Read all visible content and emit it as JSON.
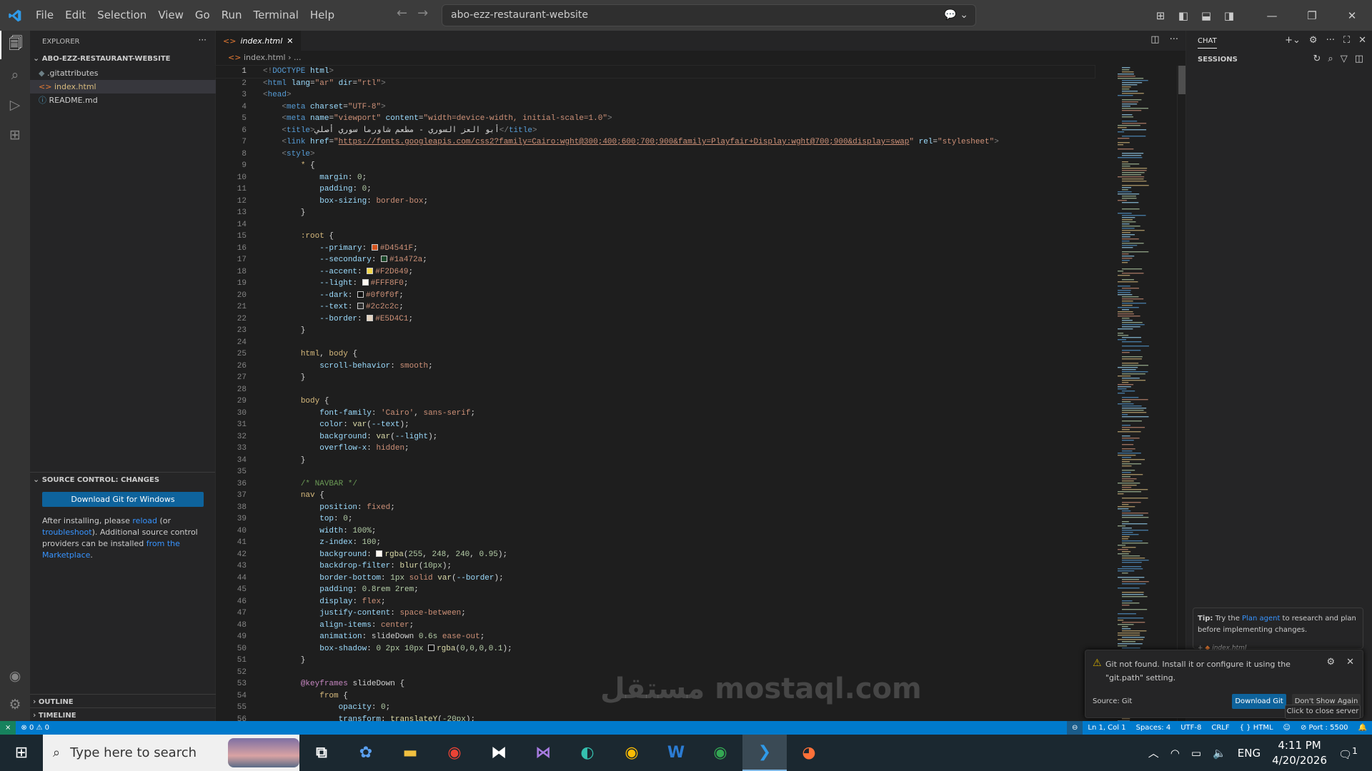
{
  "titlebar": {
    "menu": [
      "File",
      "Edit",
      "Selection",
      "View",
      "Go",
      "Run",
      "Terminal",
      "Help"
    ],
    "command_center": "abo-ezz-restaurant-website"
  },
  "sidebar": {
    "title": "EXPLORER",
    "more": "···",
    "folder": "ABO-EZZ-RESTAURANT-WEBSITE",
    "files": [
      ".gitattributes",
      "index.html",
      "README.md"
    ],
    "scm_title": "SOURCE CONTROL: CHANGES",
    "git_button": "Download Git for Windows",
    "scm_text": [
      "After installing, please ",
      "reload",
      " (or ",
      "troubleshoot",
      "). Additional source control providers can be installed ",
      "from the Marketplace",
      "."
    ],
    "outline": "OUTLINE",
    "timeline": "TIMELINE"
  },
  "editor": {
    "tab": "index.html",
    "breadcrumb": [
      "index.html",
      "..."
    ],
    "lines": [
      [
        [
          "b",
          "<!"
        ],
        [
          "t",
          "DOCTYPE "
        ],
        [
          "a",
          "html"
        ],
        [
          "b",
          ">"
        ]
      ],
      [
        [
          "b",
          "<"
        ],
        [
          "t",
          "html "
        ],
        [
          "a",
          "lang"
        ],
        [
          "p",
          "="
        ],
        [
          "s",
          "\"ar\" "
        ],
        [
          "a",
          "dir"
        ],
        [
          "p",
          "="
        ],
        [
          "s",
          "\"rtl\""
        ],
        [
          "b",
          ">"
        ]
      ],
      [
        [
          "b",
          "<"
        ],
        [
          "t",
          "head"
        ],
        [
          "b",
          ">"
        ]
      ],
      [
        [
          "p",
          "    "
        ],
        [
          "b",
          "<"
        ],
        [
          "t",
          "meta "
        ],
        [
          "a",
          "charset"
        ],
        [
          "p",
          "="
        ],
        [
          "s",
          "\"UTF-8\""
        ],
        [
          "b",
          ">"
        ]
      ],
      [
        [
          "p",
          "    "
        ],
        [
          "b",
          "<"
        ],
        [
          "t",
          "meta "
        ],
        [
          "a",
          "name"
        ],
        [
          "p",
          "="
        ],
        [
          "s",
          "\"viewport\" "
        ],
        [
          "a",
          "content"
        ],
        [
          "p",
          "="
        ],
        [
          "s",
          "\"width=device-width, initial-scale=1.0\""
        ],
        [
          "b",
          ">"
        ]
      ],
      [
        [
          "p",
          "    "
        ],
        [
          "b",
          "<"
        ],
        [
          "t",
          "title"
        ],
        [
          "b",
          ">"
        ],
        [
          "p",
          "أبو العز السوري - مطعم شاورما سوري أصلي"
        ],
        [
          "b",
          "</"
        ],
        [
          "t",
          "title"
        ],
        [
          "b",
          ">"
        ]
      ],
      [
        [
          "p",
          "    "
        ],
        [
          "b",
          "<"
        ],
        [
          "t",
          "link "
        ],
        [
          "a",
          "href"
        ],
        [
          "p",
          "="
        ],
        [
          "s",
          "\""
        ],
        [
          "u",
          "https://fonts.googleapis.com/css2?family=Cairo:wght@300;400;600;700;900&family=Playfair+Display:wght@700;900&display=swap"
        ],
        [
          "s",
          "\" "
        ],
        [
          "a",
          "rel"
        ],
        [
          "p",
          "="
        ],
        [
          "s",
          "\"stylesheet\""
        ],
        [
          "b",
          ">"
        ]
      ],
      [
        [
          "p",
          "    "
        ],
        [
          "b",
          "<"
        ],
        [
          "t",
          "style"
        ],
        [
          "b",
          ">"
        ]
      ],
      [
        [
          "p",
          "        "
        ],
        [
          "sel",
          "* "
        ],
        [
          "p",
          "{"
        ]
      ],
      [
        [
          "p",
          "            "
        ],
        [
          "a",
          "margin"
        ],
        [
          "p",
          ": "
        ],
        [
          "n",
          "0"
        ],
        [
          "p",
          ";"
        ]
      ],
      [
        [
          "p",
          "            "
        ],
        [
          "a",
          "padding"
        ],
        [
          "p",
          ": "
        ],
        [
          "n",
          "0"
        ],
        [
          "p",
          ";"
        ]
      ],
      [
        [
          "p",
          "            "
        ],
        [
          "a",
          "box-sizing"
        ],
        [
          "p",
          ": "
        ],
        [
          "s",
          "border-box"
        ],
        [
          "p",
          ";"
        ]
      ],
      [
        [
          "p",
          "        }"
        ]
      ],
      [],
      [
        [
          "p",
          "        "
        ],
        [
          "sel",
          ":root "
        ],
        [
          "p",
          "{"
        ]
      ],
      [
        [
          "p",
          "            "
        ],
        [
          "a",
          "--primary"
        ],
        [
          "p",
          ": "
        ],
        [
          "sw",
          "#D4541F"
        ],
        [
          "s",
          "#D4541F"
        ],
        [
          "p",
          ";"
        ]
      ],
      [
        [
          "p",
          "            "
        ],
        [
          "a",
          "--secondary"
        ],
        [
          "p",
          ": "
        ],
        [
          "sw",
          "#1a472a"
        ],
        [
          "s",
          "#1a472a"
        ],
        [
          "p",
          ";"
        ]
      ],
      [
        [
          "p",
          "            "
        ],
        [
          "a",
          "--accent"
        ],
        [
          "p",
          ": "
        ],
        [
          "sw",
          "#F2D649"
        ],
        [
          "s",
          "#F2D649"
        ],
        [
          "p",
          ";"
        ]
      ],
      [
        [
          "p",
          "            "
        ],
        [
          "a",
          "--light"
        ],
        [
          "p",
          ": "
        ],
        [
          "sw",
          "#FFF8F0"
        ],
        [
          "s",
          "#FFF8F0"
        ],
        [
          "p",
          ";"
        ]
      ],
      [
        [
          "p",
          "            "
        ],
        [
          "a",
          "--dark"
        ],
        [
          "p",
          ": "
        ],
        [
          "sw",
          "#0f0f0f"
        ],
        [
          "s",
          "#0f0f0f"
        ],
        [
          "p",
          ";"
        ]
      ],
      [
        [
          "p",
          "            "
        ],
        [
          "a",
          "--text"
        ],
        [
          "p",
          ": "
        ],
        [
          "sw",
          "#2c2c2c"
        ],
        [
          "s",
          "#2c2c2c"
        ],
        [
          "p",
          ";"
        ]
      ],
      [
        [
          "p",
          "            "
        ],
        [
          "a",
          "--border"
        ],
        [
          "p",
          ": "
        ],
        [
          "sw",
          "#E5D4C1"
        ],
        [
          "s",
          "#E5D4C1"
        ],
        [
          "p",
          ";"
        ]
      ],
      [
        [
          "p",
          "        }"
        ]
      ],
      [],
      [
        [
          "p",
          "        "
        ],
        [
          "sel",
          "html"
        ],
        [
          "p",
          ", "
        ],
        [
          "sel",
          "body "
        ],
        [
          "p",
          "{"
        ]
      ],
      [
        [
          "p",
          "            "
        ],
        [
          "a",
          "scroll-behavior"
        ],
        [
          "p",
          ": "
        ],
        [
          "s",
          "smooth"
        ],
        [
          "p",
          ";"
        ]
      ],
      [
        [
          "p",
          "        }"
        ]
      ],
      [],
      [
        [
          "p",
          "        "
        ],
        [
          "sel",
          "body "
        ],
        [
          "p",
          "{"
        ]
      ],
      [
        [
          "p",
          "            "
        ],
        [
          "a",
          "font-family"
        ],
        [
          "p",
          ": "
        ],
        [
          "s",
          "'Cairo'"
        ],
        [
          "p",
          ", "
        ],
        [
          "s",
          "sans-serif"
        ],
        [
          "p",
          ";"
        ]
      ],
      [
        [
          "p",
          "            "
        ],
        [
          "a",
          "color"
        ],
        [
          "p",
          ": "
        ],
        [
          "f",
          "var"
        ],
        [
          "p",
          "("
        ],
        [
          "a",
          "--text"
        ],
        [
          "p",
          ");"
        ]
      ],
      [
        [
          "p",
          "            "
        ],
        [
          "a",
          "background"
        ],
        [
          "p",
          ": "
        ],
        [
          "f",
          "var"
        ],
        [
          "p",
          "("
        ],
        [
          "a",
          "--light"
        ],
        [
          "p",
          ");"
        ]
      ],
      [
        [
          "p",
          "            "
        ],
        [
          "a",
          "overflow-x"
        ],
        [
          "p",
          ": "
        ],
        [
          "s",
          "hidden"
        ],
        [
          "p",
          ";"
        ]
      ],
      [
        [
          "p",
          "        }"
        ]
      ],
      [],
      [
        [
          "p",
          "        "
        ],
        [
          "c",
          "/* NAVBAR */"
        ]
      ],
      [
        [
          "p",
          "        "
        ],
        [
          "sel",
          "nav "
        ],
        [
          "p",
          "{"
        ]
      ],
      [
        [
          "p",
          "            "
        ],
        [
          "a",
          "position"
        ],
        [
          "p",
          ": "
        ],
        [
          "s",
          "fixed"
        ],
        [
          "p",
          ";"
        ]
      ],
      [
        [
          "p",
          "            "
        ],
        [
          "a",
          "top"
        ],
        [
          "p",
          ": "
        ],
        [
          "n",
          "0"
        ],
        [
          "p",
          ";"
        ]
      ],
      [
        [
          "p",
          "            "
        ],
        [
          "a",
          "width"
        ],
        [
          "p",
          ": "
        ],
        [
          "n",
          "100%"
        ],
        [
          "p",
          ";"
        ]
      ],
      [
        [
          "p",
          "            "
        ],
        [
          "a",
          "z-index"
        ],
        [
          "p",
          ": "
        ],
        [
          "n",
          "100"
        ],
        [
          "p",
          ";"
        ]
      ],
      [
        [
          "p",
          "            "
        ],
        [
          "a",
          "background"
        ],
        [
          "p",
          ": "
        ],
        [
          "sw",
          "#FFF8F0"
        ],
        [
          "f",
          "rgba"
        ],
        [
          "p",
          "("
        ],
        [
          "n",
          "255"
        ],
        [
          "p",
          ", "
        ],
        [
          "n",
          "248"
        ],
        [
          "p",
          ", "
        ],
        [
          "n",
          "240"
        ],
        [
          "p",
          ", "
        ],
        [
          "n",
          "0.95"
        ],
        [
          "p",
          ");"
        ]
      ],
      [
        [
          "p",
          "            "
        ],
        [
          "a",
          "backdrop-filter"
        ],
        [
          "p",
          ": "
        ],
        [
          "f",
          "blur"
        ],
        [
          "p",
          "("
        ],
        [
          "n",
          "10px"
        ],
        [
          "p",
          ");"
        ]
      ],
      [
        [
          "p",
          "            "
        ],
        [
          "a",
          "border-bottom"
        ],
        [
          "p",
          ": "
        ],
        [
          "n",
          "1px "
        ],
        [
          "s",
          "solid "
        ],
        [
          "f",
          "var"
        ],
        [
          "p",
          "("
        ],
        [
          "a",
          "--border"
        ],
        [
          "p",
          ");"
        ]
      ],
      [
        [
          "p",
          "            "
        ],
        [
          "a",
          "padding"
        ],
        [
          "p",
          ": "
        ],
        [
          "n",
          "0.8rem 2rem"
        ],
        [
          "p",
          ";"
        ]
      ],
      [
        [
          "p",
          "            "
        ],
        [
          "a",
          "display"
        ],
        [
          "p",
          ": "
        ],
        [
          "s",
          "flex"
        ],
        [
          "p",
          ";"
        ]
      ],
      [
        [
          "p",
          "            "
        ],
        [
          "a",
          "justify-content"
        ],
        [
          "p",
          ": "
        ],
        [
          "s",
          "space-between"
        ],
        [
          "p",
          ";"
        ]
      ],
      [
        [
          "p",
          "            "
        ],
        [
          "a",
          "align-items"
        ],
        [
          "p",
          ": "
        ],
        [
          "s",
          "center"
        ],
        [
          "p",
          ";"
        ]
      ],
      [
        [
          "p",
          "            "
        ],
        [
          "a",
          "animation"
        ],
        [
          "p",
          ": "
        ],
        [
          "p",
          "slideDown "
        ],
        [
          "n",
          "0.6s "
        ],
        [
          "s",
          "ease-out"
        ],
        [
          "p",
          ";"
        ]
      ],
      [
        [
          "p",
          "            "
        ],
        [
          "a",
          "box-shadow"
        ],
        [
          "p",
          ": "
        ],
        [
          "n",
          "0 2px 10px "
        ],
        [
          "sw",
          "#000000"
        ],
        [
          "f",
          "rgba"
        ],
        [
          "p",
          "("
        ],
        [
          "n",
          "0"
        ],
        [
          "p",
          ","
        ],
        [
          "n",
          "0"
        ],
        [
          "p",
          ","
        ],
        [
          "n",
          "0"
        ],
        [
          "p",
          ","
        ],
        [
          "n",
          "0.1"
        ],
        [
          "p",
          ");"
        ]
      ],
      [
        [
          "p",
          "        }"
        ]
      ],
      [],
      [
        [
          "p",
          "        "
        ],
        [
          "k",
          "@keyframes "
        ],
        [
          "p",
          "slideDown {"
        ]
      ],
      [
        [
          "p",
          "            "
        ],
        [
          "sel",
          "from "
        ],
        [
          "p",
          "{"
        ]
      ],
      [
        [
          "p",
          "                "
        ],
        [
          "a",
          "opacity"
        ],
        [
          "p",
          ": "
        ],
        [
          "n",
          "0"
        ],
        [
          "p",
          ";"
        ]
      ],
      [
        [
          "p",
          "                "
        ],
        [
          "a",
          "transform"
        ],
        [
          "p",
          ": "
        ],
        [
          "f",
          "translateY"
        ],
        [
          "p",
          "("
        ],
        [
          "n",
          "-20px"
        ],
        [
          "p",
          ");"
        ]
      ]
    ]
  },
  "chat": {
    "tab": "CHAT",
    "sessions": "SESSIONS",
    "tip_label": "Tip:",
    "tip_text_1": " Try the ",
    "tip_link": "Plan agent",
    "tip_text_2": " to research and plan before implementing changes.",
    "attachment": "index.html"
  },
  "notification": {
    "message": "Git not found. Install it or configure it using the \"git.path\" setting.",
    "source": "Source: Git",
    "primary": "Download Git",
    "secondary": "Don't Show Again",
    "tooltip": "Click to close server"
  },
  "status": {
    "errors": "0",
    "warnings": "0",
    "position": "Ln 1, Col 1",
    "spaces": "Spaces: 4",
    "encoding": "UTF-8",
    "eol": "CRLF",
    "language": "HTML",
    "port": "Port : 5500"
  },
  "taskbar": {
    "search_placeholder": "Type here to search",
    "apps": [
      "copilot",
      "file-explorer",
      "chrome",
      "capcut",
      "visual-studio",
      "edge",
      "chrome-profile",
      "word",
      "chrome-profile-2",
      "vscode",
      "firefox"
    ],
    "lang": "ENG",
    "time": "4:11 PM",
    "date": "4/20/2026",
    "notifications": "1"
  },
  "watermark": "مستقل mostaql.com"
}
